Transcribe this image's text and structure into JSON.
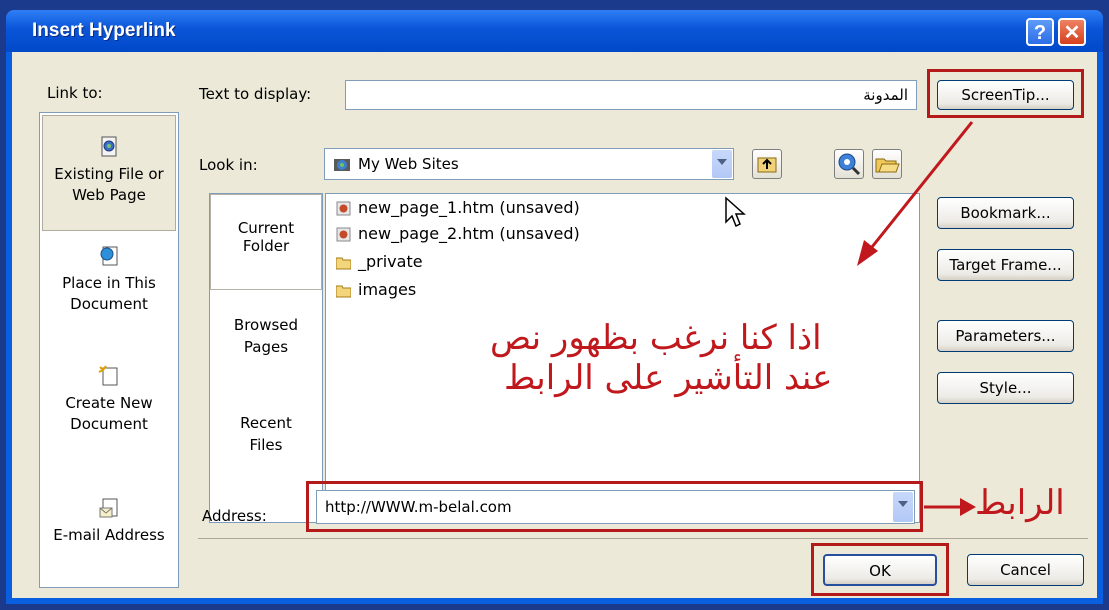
{
  "window": {
    "title": "Insert Hyperlink",
    "help_glyph": "?",
    "close_glyph": "✕"
  },
  "link_to": {
    "label": "Link to:",
    "items": [
      {
        "label1": "Existing File or",
        "label2": "Web Page",
        "icon": "existing-file-icon",
        "selected": true
      },
      {
        "label1": "Place in This",
        "label2": "Document",
        "icon": "place-in-document-icon",
        "selected": false
      },
      {
        "label1": "Create New",
        "label2": "Document",
        "icon": "new-document-icon",
        "selected": false
      },
      {
        "label1": "E-mail Address",
        "label2": "",
        "icon": "email-icon",
        "selected": false
      }
    ]
  },
  "text_to_display": {
    "label": "Text to display:",
    "value": "المدونة"
  },
  "screentip_button": "ScreenTip...",
  "look_in": {
    "label": "Look in:",
    "value": "My Web Sites"
  },
  "nav_panel": {
    "current": {
      "line1": "Current",
      "line2": "Folder"
    },
    "browsed": {
      "line1": "Browsed",
      "line2": "Pages"
    },
    "recent": {
      "line1": "Recent",
      "line2": "Files"
    }
  },
  "files": [
    {
      "name": "new_page_1.htm (unsaved)",
      "type": "htm"
    },
    {
      "name": "new_page_2.htm (unsaved)",
      "type": "htm"
    },
    {
      "name": "_private",
      "type": "folder"
    },
    {
      "name": "images",
      "type": "folder"
    }
  ],
  "right_buttons": {
    "bookmark": "Bookmark...",
    "target_frame": "Target Frame...",
    "parameters": "Parameters...",
    "style": "Style..."
  },
  "address": {
    "label": "Address:",
    "value": "http://WWW.m-belal.com"
  },
  "ok_button": "OK",
  "cancel_button": "Cancel",
  "annotations": {
    "line1": "اذا كنا نرغب بظهور نص",
    "line2": "عند التأشير على الرابط",
    "link_label": "الرابط"
  },
  "colors": {
    "accent_red": "#c0181c",
    "titlebar_blue": "#0a55d8"
  }
}
